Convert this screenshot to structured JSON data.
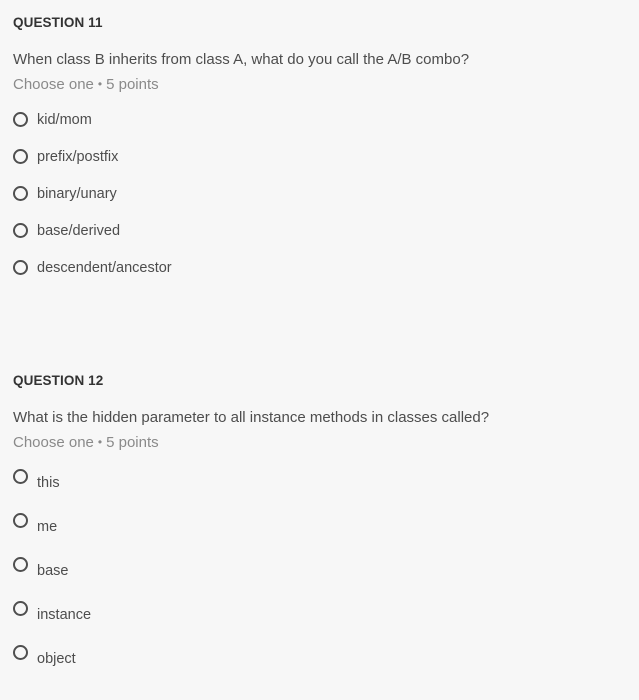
{
  "questions": [
    {
      "heading": "QUESTION 11",
      "text": "When class B inherits from class A, what do you call the A/B combo?",
      "meta": {
        "mode": "Choose one",
        "separator": "•",
        "points": "5 points"
      },
      "options": [
        {
          "label": "kid/mom",
          "selected": false
        },
        {
          "label": "prefix/postfix",
          "selected": false
        },
        {
          "label": "binary/unary",
          "selected": false
        },
        {
          "label": "base/derived",
          "selected": false
        },
        {
          "label": "descendent/ancestor",
          "selected": false
        }
      ]
    },
    {
      "heading": "QUESTION 12",
      "text": "What is the hidden parameter to all instance methods in classes called?",
      "meta": {
        "mode": "Choose one",
        "separator": "•",
        "points": "5 points"
      },
      "options": [
        {
          "label": "this",
          "selected": false
        },
        {
          "label": "me",
          "selected": false
        },
        {
          "label": "base",
          "selected": false
        },
        {
          "label": "instance",
          "selected": false
        },
        {
          "label": "object",
          "selected": false
        }
      ]
    }
  ],
  "colors": {
    "background": "#f7f7f7",
    "text": "#4d4d4d",
    "muted": "#8a8a8a",
    "radio_border": "#4f4f4f"
  }
}
